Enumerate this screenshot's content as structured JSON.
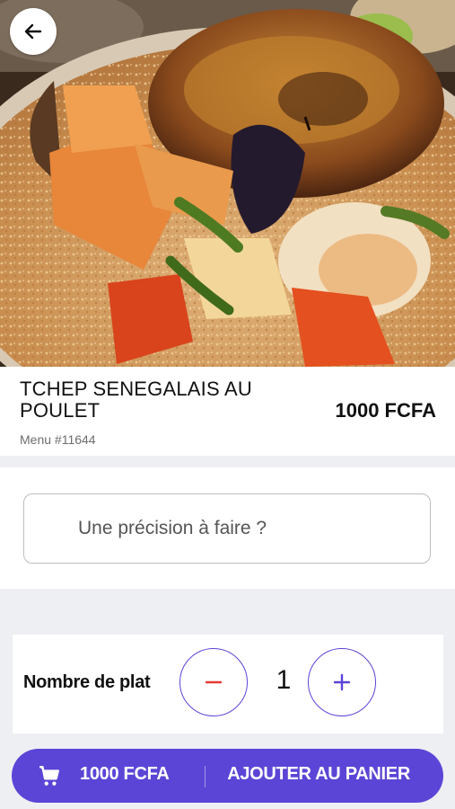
{
  "header": {
    "back_icon": "arrow-left-icon",
    "image_alt": "Tchep dish photo"
  },
  "dish": {
    "name": "TCHEP SENEGALAIS AU POULET",
    "price": "1000 FCFA",
    "reference": "Menu #11644"
  },
  "note": {
    "placeholder": "Une précision à faire ?",
    "value": ""
  },
  "quantity": {
    "label": "Nombre de plat",
    "value": "1",
    "minus_icon": "minus-icon",
    "plus_icon": "plus-icon"
  },
  "cart": {
    "icon": "cart-icon",
    "total": "1000 FCFA",
    "action": "AJOUTER AU PANIER"
  },
  "colors": {
    "accent": "#5b45d6",
    "minus": "#e53935",
    "background": "#eeeff3"
  }
}
